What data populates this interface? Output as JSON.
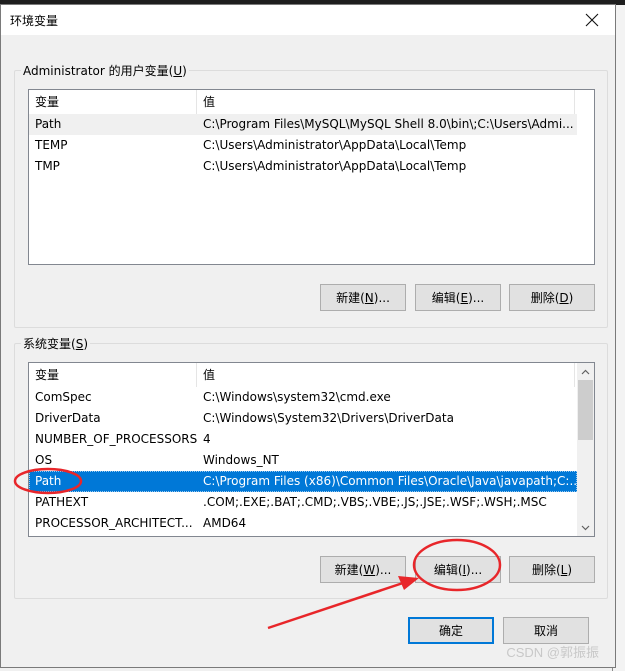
{
  "window": {
    "title": "环境变量",
    "close_icon": "close-icon"
  },
  "user_vars": {
    "label": "Administrator 的用户变量",
    "accel": "U",
    "headers": {
      "name": "变量",
      "value": "值"
    },
    "rows": [
      {
        "name": "Path",
        "value": "C:\\Program Files\\MySQL\\MySQL Shell 8.0\\bin\\;C:\\Users\\Admi..."
      },
      {
        "name": "TEMP",
        "value": "C:\\Users\\Administrator\\AppData\\Local\\Temp"
      },
      {
        "name": "TMP",
        "value": "C:\\Users\\Administrator\\AppData\\Local\\Temp"
      }
    ],
    "buttons": {
      "new": {
        "pre": "新建(",
        "accel": "N",
        "post": ")..."
      },
      "edit": {
        "pre": "编辑(",
        "accel": "E",
        "post": ")..."
      },
      "delete": {
        "pre": "删除(",
        "accel": "D",
        "post": ")"
      }
    }
  },
  "system_vars": {
    "label": "系统变量",
    "accel": "S",
    "headers": {
      "name": "变量",
      "value": "值"
    },
    "rows": [
      {
        "name": "ComSpec",
        "value": "C:\\Windows\\system32\\cmd.exe"
      },
      {
        "name": "DriverData",
        "value": "C:\\Windows\\System32\\Drivers\\DriverData"
      },
      {
        "name": "NUMBER_OF_PROCESSORS",
        "value": "4"
      },
      {
        "name": "OS",
        "value": "Windows_NT"
      },
      {
        "name": "Path",
        "value": "C:\\Program Files (x86)\\Common Files\\Oracle\\Java\\javapath;C:..."
      },
      {
        "name": "PATHEXT",
        "value": ".COM;.EXE;.BAT;.CMD;.VBS;.VBE;.JS;.JSE;.WSF;.WSH;.MSC"
      },
      {
        "name": "PROCESSOR_ARCHITECT...",
        "value": "AMD64"
      }
    ],
    "selected_row": "Path",
    "buttons": {
      "new": {
        "pre": "新建(",
        "accel": "W",
        "post": ")..."
      },
      "edit": {
        "pre": "编辑(",
        "accel": "I",
        "post": ")..."
      },
      "delete": {
        "pre": "删除(",
        "accel": "L",
        "post": ")"
      }
    },
    "scrollbar": {
      "up_icon": "chevron-up-icon",
      "down_icon": "chevron-down-icon"
    }
  },
  "footer": {
    "ok": "确定",
    "cancel": "取消"
  },
  "annotations": {
    "color": "#e8262a"
  },
  "watermark": "CSDN @郭振振"
}
